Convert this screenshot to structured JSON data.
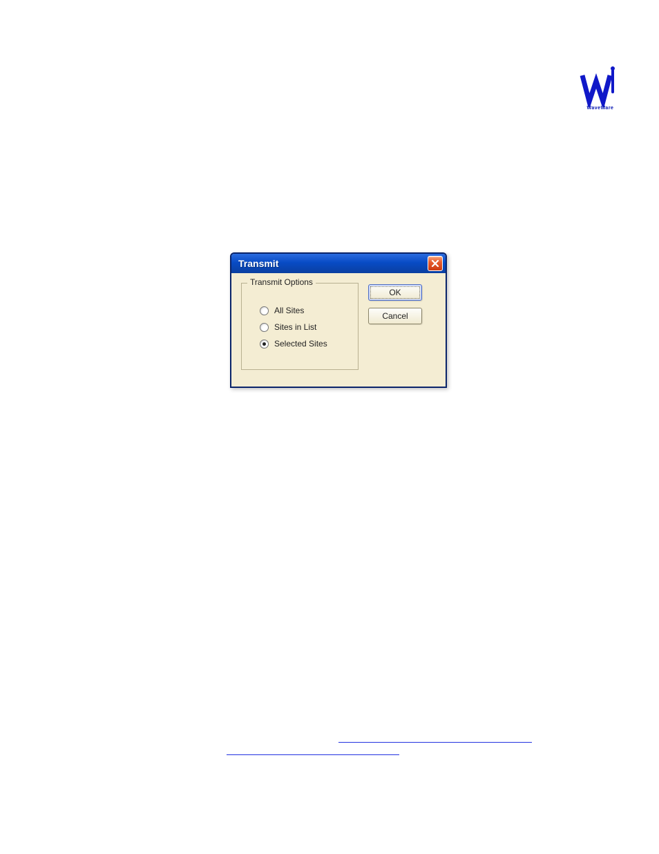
{
  "logo": {
    "caption": "WaveWare"
  },
  "dialog": {
    "title": "Transmit",
    "group_title": "Transmit Options",
    "options": [
      {
        "label": "All Sites",
        "selected": false
      },
      {
        "label": "Sites in List",
        "selected": false
      },
      {
        "label": "Selected Sites",
        "selected": true
      }
    ],
    "ok_label": "OK",
    "cancel_label": "Cancel"
  }
}
